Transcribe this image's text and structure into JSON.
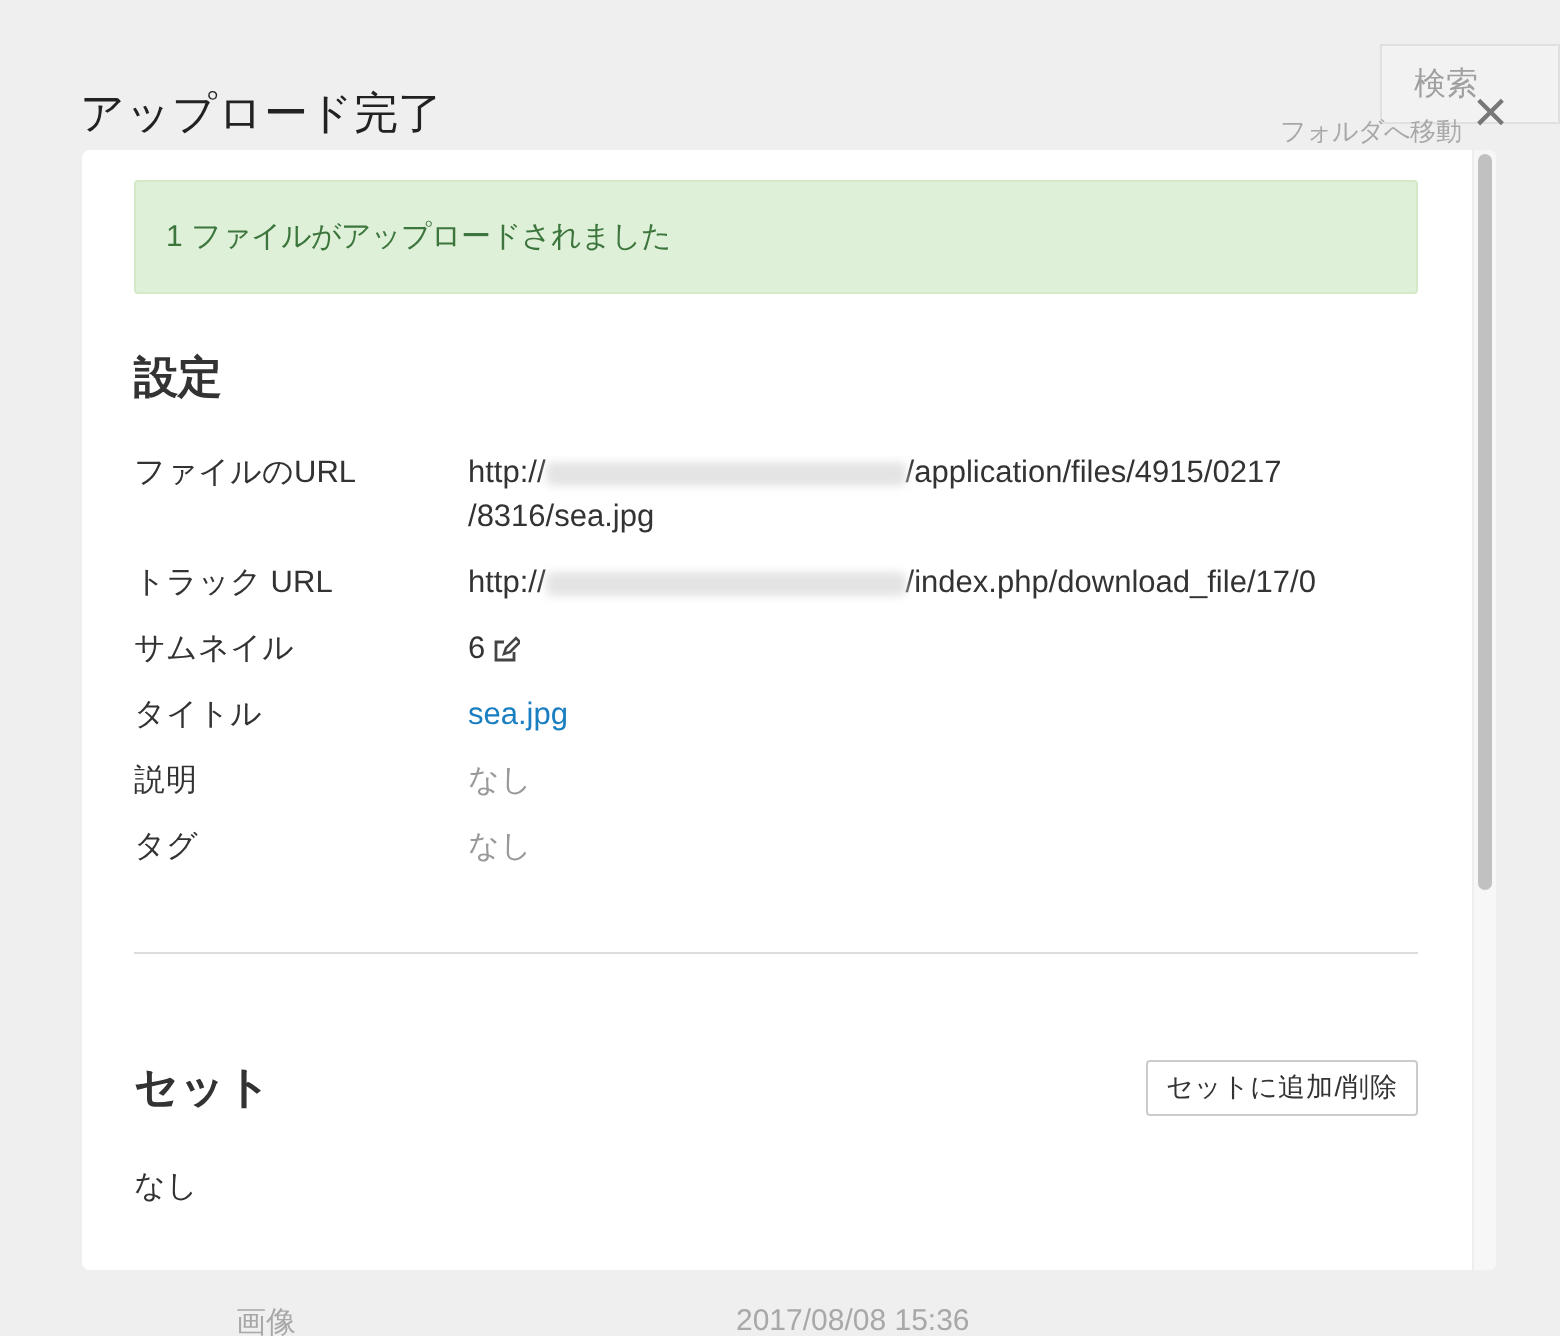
{
  "background": {
    "search_button": "検索",
    "folder_link": "フォルダへ移動",
    "row": {
      "type": "画像",
      "date": "2017/08/08 15:36"
    }
  },
  "dialog": {
    "title": "アップロード完了",
    "close": "×",
    "alert": "1 ファイルがアップロードされました",
    "settings": {
      "heading": "設定",
      "rows": [
        {
          "label": "ファイルのURL",
          "kind": "url",
          "prefix": "http://",
          "suffix": "/application/files/4915/0217/8316/sea.jpg"
        },
        {
          "label": "トラック URL",
          "kind": "url",
          "prefix": "http://",
          "suffix": "/index.php/download_file/17/0"
        },
        {
          "label": "サムネイル",
          "kind": "edit",
          "value": "6"
        },
        {
          "label": "タイトル",
          "kind": "link",
          "value": "sea.jpg"
        },
        {
          "label": "説明",
          "kind": "muted",
          "value": "なし"
        },
        {
          "label": "タグ",
          "kind": "muted",
          "value": "なし"
        }
      ]
    },
    "sets": {
      "heading": "セット",
      "button": "セットに追加/削除",
      "value": "なし"
    }
  }
}
